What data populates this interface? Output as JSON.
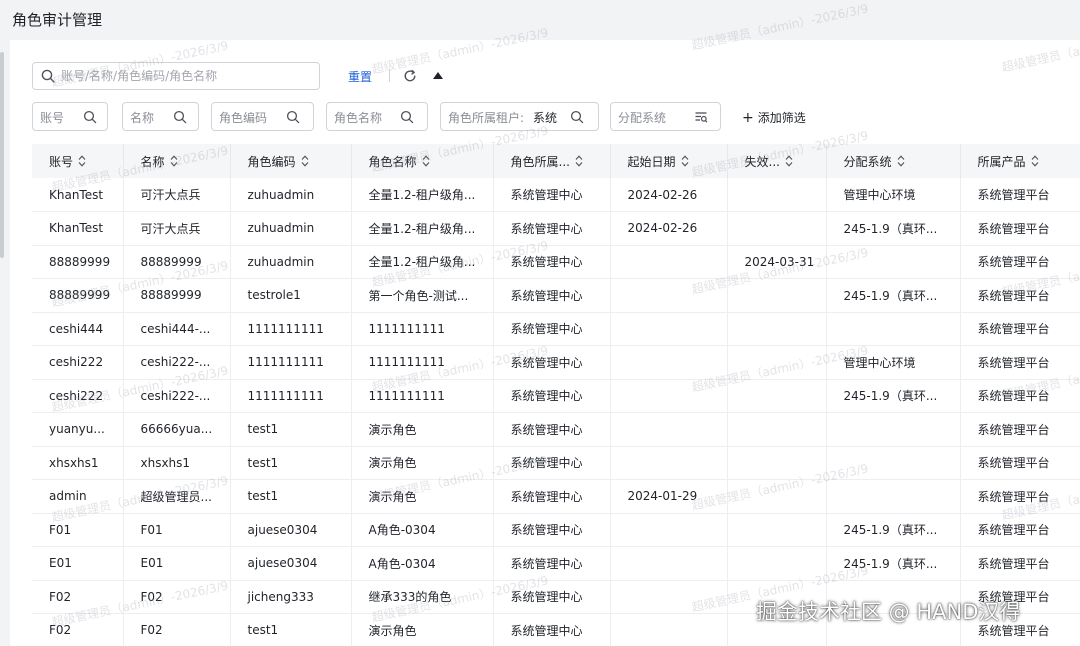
{
  "page": {
    "title": "角色审计管理"
  },
  "toolbar": {
    "search_placeholder": "账号/名称/角色编码/角色名称",
    "reset_label": "重置"
  },
  "filters": [
    {
      "label": "账号",
      "value": ""
    },
    {
      "label": "名称",
      "value": ""
    },
    {
      "label": "角色编码",
      "value": ""
    },
    {
      "label": "角色名称",
      "value": ""
    },
    {
      "label": "角色所属租户:",
      "value": "系统"
    },
    {
      "label": "分配系统",
      "value": ""
    }
  ],
  "add_filter_label": "添加筛选",
  "table": {
    "columns": [
      "账号",
      "名称",
      "角色编码",
      "角色名称",
      "角色所属...",
      "起始日期",
      "失效...",
      "分配系统",
      "所属产品"
    ],
    "rows": [
      [
        "KhanTest",
        "可汗大点兵",
        "zuhuadmin",
        "全量1.2-租户级角...",
        "系统管理中心",
        "2024-02-26",
        "",
        "管理中心环境",
        "系统管理平台"
      ],
      [
        "KhanTest",
        "可汗大点兵",
        "zuhuadmin",
        "全量1.2-租户级角...",
        "系统管理中心",
        "2024-02-26",
        "",
        "245-1.9（真环...",
        "系统管理平台"
      ],
      [
        "88889999",
        "88889999",
        "zuhuadmin",
        "全量1.2-租户级角...",
        "系统管理中心",
        "",
        "2024-03-31",
        "",
        "系统管理平台"
      ],
      [
        "88889999",
        "88889999",
        "testrole1",
        "第一个角色-测试...",
        "系统管理中心",
        "",
        "",
        "245-1.9（真环...",
        "系统管理平台"
      ],
      [
        "ceshi444",
        "ceshi444-...",
        "1111111111",
        "1111111111",
        "系统管理中心",
        "",
        "",
        "",
        "系统管理平台"
      ],
      [
        "ceshi222",
        "ceshi222-...",
        "1111111111",
        "1111111111",
        "系统管理中心",
        "",
        "",
        "管理中心环境",
        "系统管理平台"
      ],
      [
        "ceshi222",
        "ceshi222-...",
        "1111111111",
        "1111111111",
        "系统管理中心",
        "",
        "",
        "245-1.9（真环...",
        "系统管理平台"
      ],
      [
        "yuanyu...",
        "66666yua...",
        "test1",
        "演示角色",
        "系统管理中心",
        "",
        "",
        "",
        "系统管理平台"
      ],
      [
        "xhsxhs1",
        "xhsxhs1",
        "test1",
        "演示角色",
        "系统管理中心",
        "",
        "",
        "",
        "系统管理平台"
      ],
      [
        "admin",
        "超级管理员...",
        "test1",
        "演示角色",
        "系统管理中心",
        "2024-01-29",
        "",
        "",
        "系统管理平台"
      ],
      [
        "F01",
        "F01",
        "ajuese0304",
        "A角色-0304",
        "系统管理中心",
        "",
        "",
        "245-1.9（真环...",
        "系统管理平台"
      ],
      [
        "E01",
        "E01",
        "ajuese0304",
        "A角色-0304",
        "系统管理中心",
        "",
        "",
        "245-1.9（真环...",
        "系统管理平台"
      ],
      [
        "F02",
        "F02",
        "jicheng333",
        "继承333的角色",
        "系统管理中心",
        "",
        "",
        "",
        "系统管理平台"
      ],
      [
        "F02",
        "F02",
        "test1",
        "演示角色",
        "系统管理中心",
        "",
        "",
        "",
        "系统管理平台"
      ]
    ]
  },
  "watermark_text": "超级管理员（admin）-2026/3/9",
  "credit_text": "掘金技术社区 @ HAND汉得"
}
